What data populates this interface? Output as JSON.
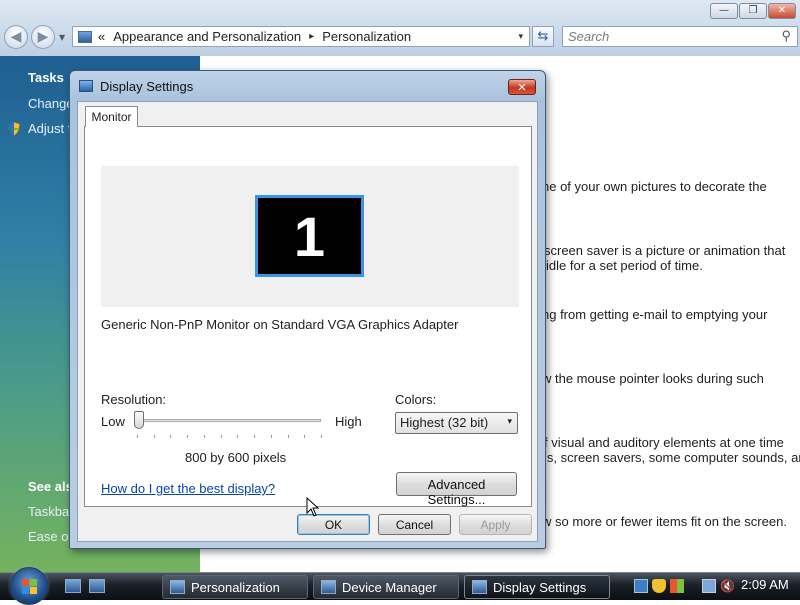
{
  "explorer": {
    "caption_buttons": {
      "minimize": "—",
      "maximize": "❐",
      "close": "✕"
    },
    "nav": {
      "back_icon": "back-arrow-icon",
      "forward_icon": "forward-arrow-icon"
    },
    "address": {
      "prefix": "«",
      "crumb1": "Appearance and Personalization",
      "separator": "▸",
      "crumb2": "Personalization",
      "dropdown": "▾"
    },
    "refresh_glyph": "⇆",
    "search": {
      "placeholder": "Search",
      "icon": "⚲"
    },
    "sidebar": {
      "tasks_heading": "Tasks",
      "link1": "Change",
      "link2": "Adjust f",
      "see_also_heading": "See also",
      "link3": "Taskbar",
      "link4": "Ease of"
    },
    "content_lines": [
      "ne of your own pictures to decorate the",
      "screen saver is a picture or animation that",
      "idle for a set period of time.",
      "ng from getting e-mail to emptying your",
      "w the mouse pointer looks during such",
      "f visual and auditory elements at one time",
      "ls, screen savers, some computer sounds, and",
      "w so more or fewer items fit on the screen."
    ]
  },
  "dialog": {
    "title": "Display Settings",
    "close_glyph": "✕",
    "tab_label": "Monitor",
    "monitor_number": "1",
    "adapter_text": "Generic Non-PnP Monitor on Standard VGA Graphics Adapter",
    "resolution": {
      "label": "Resolution:",
      "low": "Low",
      "high": "High",
      "value_text": "800 by 600 pixels",
      "slider_position": 0
    },
    "colors": {
      "label": "Colors:",
      "selected": "Highest (32 bit)",
      "arrow": "▾"
    },
    "help_link": "How do I get the best display?",
    "advanced_button": "Advanced Settings...",
    "ok_button": "OK",
    "cancel_button": "Cancel",
    "apply_button": "Apply"
  },
  "taskbar": {
    "tasks": [
      "Personalization",
      "Device Manager",
      "Display Settings"
    ],
    "active_task": "Display Settings",
    "clock": "2:09 AM"
  },
  "colors": {
    "accent_blue": "#3794e6",
    "link": "#0645ad",
    "close_red": "#c3391f"
  }
}
